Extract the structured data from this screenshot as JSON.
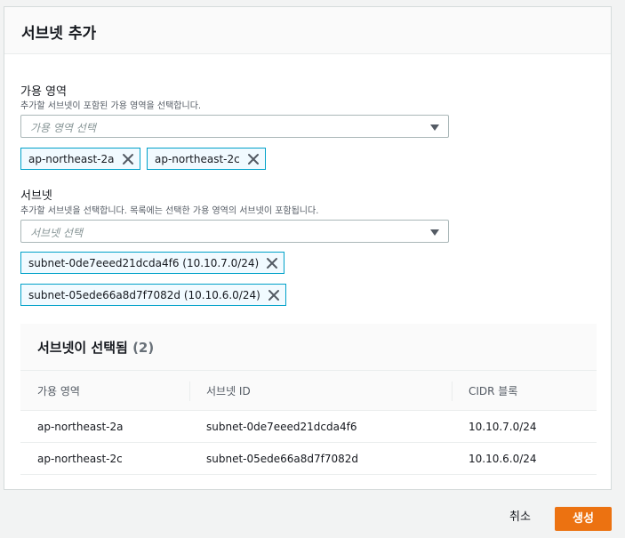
{
  "modal": {
    "title": "서브넷 추가"
  },
  "availability_zone": {
    "label": "가용 영역",
    "description": "추가할 서브넷이 포함된 가용 영역을 선택합니다.",
    "placeholder": "가용 영역 선택",
    "selected": [
      {
        "value": "ap-northeast-2a"
      },
      {
        "value": "ap-northeast-2c"
      }
    ]
  },
  "subnets": {
    "label": "서브넷",
    "description": "추가할 서브넷을 선택합니다. 목록에는 선택한 가용 영역의 서브넷이 포함됩니다.",
    "placeholder": "서브넷 선택",
    "selected": [
      {
        "value": "subnet-0de7eeed21dcda4f6 (10.10.7.0/24)"
      },
      {
        "value": "subnet-05ede66a8d7f7082d (10.10.6.0/24)"
      }
    ]
  },
  "selected_table": {
    "title": "서브넷이 선택됨",
    "count": "(2)",
    "columns": [
      "가용 영역",
      "서브넷 ID",
      "CIDR 블록"
    ],
    "rows": [
      [
        "ap-northeast-2a",
        "subnet-0de7eeed21dcda4f6",
        "10.10.7.0/24"
      ],
      [
        "ap-northeast-2c",
        "subnet-05ede66a8d7f7082d",
        "10.10.6.0/24"
      ]
    ]
  },
  "footer": {
    "cancel_label": "취소",
    "create_label": "생성"
  },
  "colors": {
    "primary_button": "#ec7211",
    "token_border": "#00a1c9",
    "token_bg": "#f1faff"
  }
}
